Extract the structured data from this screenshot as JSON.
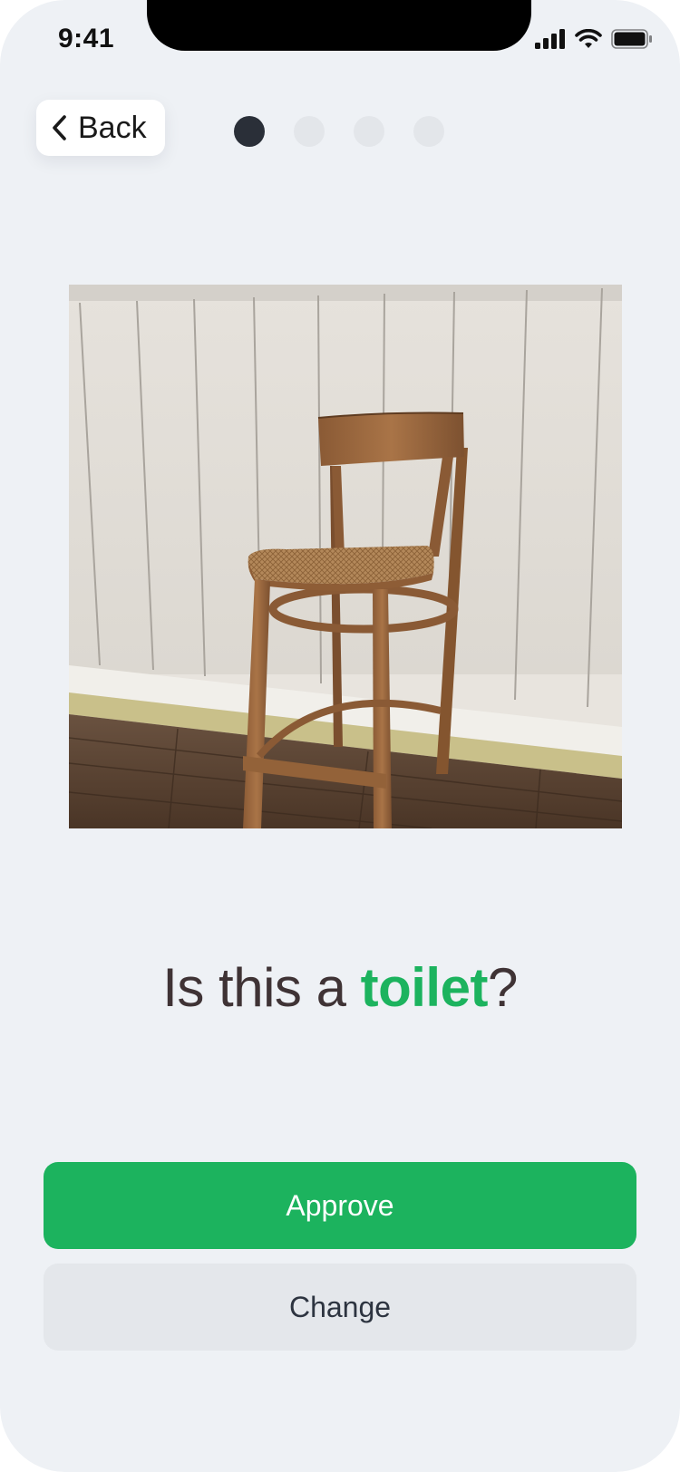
{
  "status_bar": {
    "time": "9:41"
  },
  "nav": {
    "back_label": "Back",
    "back_icon": "chevron-left-icon"
  },
  "progress": {
    "total_steps": 4,
    "current_step": 1
  },
  "question": {
    "prefix": "Is this a ",
    "highlight": "toilet",
    "suffix": "?"
  },
  "actions": {
    "approve_label": "Approve",
    "change_label": "Change"
  },
  "colors": {
    "accent": "#1cb35e",
    "background": "#eef1f5",
    "text": "#3f3335",
    "dot_active": "#2a2f38",
    "dot_inactive": "#e3e6ea"
  }
}
